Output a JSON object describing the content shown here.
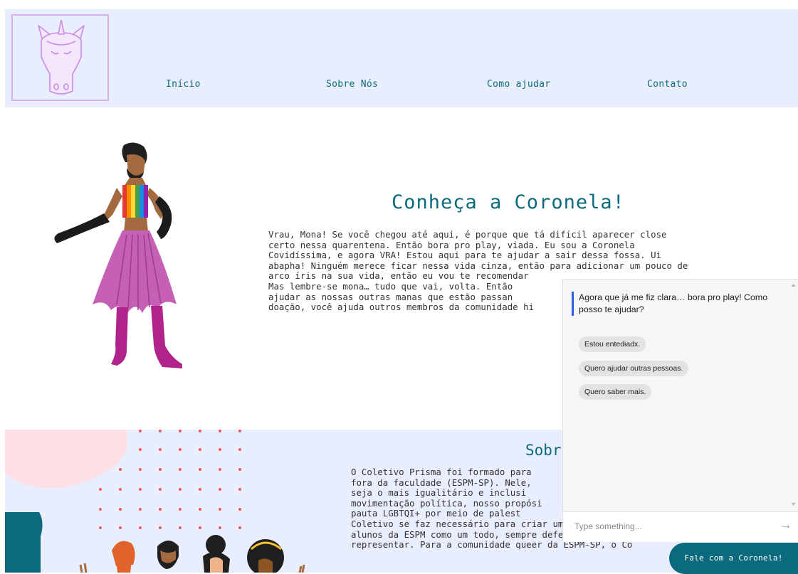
{
  "header": {
    "logo_alt": "unicorn-logo",
    "nav": [
      {
        "label": "Início"
      },
      {
        "label": "Sobre Nós"
      },
      {
        "label": "Como ajudar"
      },
      {
        "label": "Contato"
      }
    ]
  },
  "hero": {
    "title": "Conheça a Coronela!",
    "lines": [
      "Vrau, Mona! Se você chegou até aqui, é porque que tá difícil aparecer close",
      "certo nessa quarentena. Então bora pro play, viada. Eu sou a Coronela",
      "Covidíssima, e agora VRA! Estou aqui para te ajudar a sair dessa fossa. Ui",
      "abapha! Ninguém merece ficar nessa vida cinza, então para adicionar um pouco de",
      "arco íris na sua vida, então eu vou te recomendar",
      "Mas lembre-se mona… tudo que vai, volta. Então",
      "ajudar as nossas outras manas que estão passan",
      "doação, você ajuda outros membros da comunidade hi"
    ]
  },
  "about": {
    "title": "Sobr",
    "lines": [
      "O Coletivo Prisma foi formado para",
      "fora da faculdade (ESPM-SP). Nele,",
      "seja o mais igualitário e inclusi",
      "movimentação política, nosso propósi",
      "pauta LGBTQI+ por meio de palest",
      "Coletivo se faz necessário para criar um debate e",
      "alunos da ESPM como um todo, sempre defendendo as pe",
      "representar. Para a comunidade queer da ESPM-SP, o Co"
    ]
  },
  "chat": {
    "message": "Agora que já me fiz clara… bora pro play! Como posso te ajudar?",
    "options": [
      "Estou entediadx.",
      "Quero ajudar outras pessoas.",
      "Quero saber mais."
    ],
    "input_placeholder": "Type something...",
    "send_icon": "→",
    "launcher_label": "Fale com a Coronela!"
  },
  "colors": {
    "accent": "#0c6a7e",
    "header_bg": "#e8eefd",
    "logo_border": "#d7b2ea",
    "chat_bar": "#2f5be0"
  }
}
